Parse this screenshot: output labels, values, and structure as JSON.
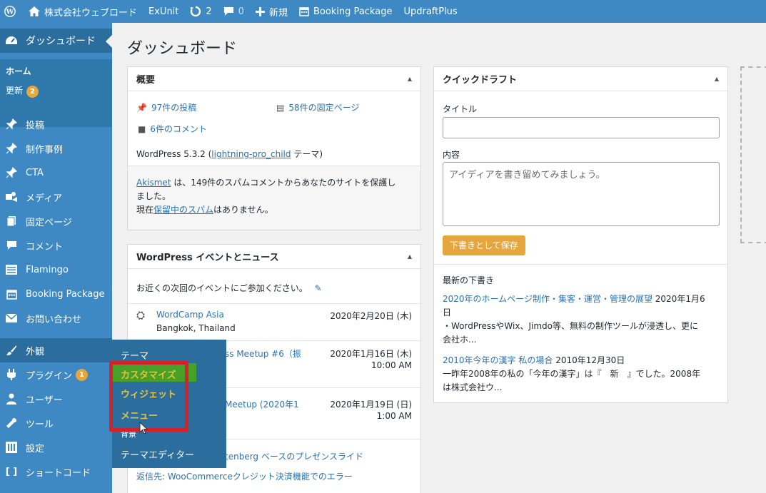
{
  "adminbar": {
    "site_name": "株式会社ウェブロード",
    "exunit": "ExUnit",
    "updates_count": "2",
    "comments_count": "0",
    "new_label": "新規",
    "booking": "Booking Package",
    "updraft": "UpdraftPlus"
  },
  "sidebar": {
    "dashboard": "ダッシュボード",
    "home": "ホーム",
    "updates": "更新",
    "updates_badge": "2",
    "items": [
      {
        "label": "投稿"
      },
      {
        "label": "制作事例"
      },
      {
        "label": "CTA"
      },
      {
        "label": "メディア"
      },
      {
        "label": "固定ページ"
      },
      {
        "label": "コメント"
      },
      {
        "label": "Flamingo"
      },
      {
        "label": "Booking Package"
      },
      {
        "label": "お問い合わせ"
      },
      {
        "label": "外観"
      },
      {
        "label": "プラグイン"
      },
      {
        "label": "ユーザー"
      },
      {
        "label": "ツール"
      },
      {
        "label": "設定"
      },
      {
        "label": "ショートコード"
      }
    ],
    "plugins_badge": "1"
  },
  "flyout": {
    "theme": "テーマ",
    "customize": "カスタマイズ",
    "widgets": "ウィジェット",
    "menus": "メニュー",
    "background": "背景",
    "theme_editor": "テーマエディター"
  },
  "page_title": "ダッシュボード",
  "glance": {
    "title": "概要",
    "posts": "97件の投稿",
    "pages": "58件の固定ページ",
    "comments": "6件のコメント",
    "wp_version_prefix": "WordPress 5.3.2 (",
    "theme_link": "lightning-pro_child",
    "wp_version_suffix": " テーマ)",
    "akismet_link": "Akismet",
    "akismet_text1": " は、149件のスパムコメントからあなたのサイトを保護し",
    "akismet_text2": "ました。",
    "spam_prefix": "現在",
    "spam_link": "保留中のスパム",
    "spam_suffix": "はありません。"
  },
  "events": {
    "title": "WordPress イベントとニュース",
    "intro": "お近くの次回のイベントにご参加ください。",
    "list": [
      {
        "name": "WordCamp Asia",
        "location": "Bangkok, Thailand",
        "date": "2020年2月20日 (木)",
        "time": ""
      },
      {
        "name": "ss Meetup #6（振",
        "location": "",
        "date": "2020年1月16日 (木)",
        "time": "10:00 AM"
      },
      {
        "name": "Meetup (2020年1",
        "location": "",
        "date": "2020年1月19日 (日)",
        "time": "1:00 AM"
      }
    ],
    "news1": "tenberg ベースのプレゼンスライド",
    "news2": "返信先: WooCommerceクレジット決済機能でのエラー"
  },
  "quick_draft": {
    "title": "クイックドラフト",
    "title_label": "タイトル",
    "content_label": "内容",
    "content_placeholder": "アイディアを書き留めてみましょう。",
    "save_button": "下書きとして保存",
    "recent_heading": "最新の下書き",
    "drafts": [
      {
        "title": "2020年のホームページ制作・集客・運営・管理の展望",
        "date": "2020年1月6",
        "date2": "日",
        "excerpt1": "・WordPressやWix、Jimdo等、無料の制作ツールが浸透し、更に",
        "excerpt2": "会社ホ..."
      },
      {
        "title": "2010年今年の漢字 私の場合",
        "date": "2010年12月30日",
        "excerpt1": "一昨年2008年の私の「今年の漢字」は『　新　』でした。2008年",
        "excerpt2": "は株式会社ウ..."
      }
    ]
  },
  "colors": {
    "adminbar": "#3e88c3",
    "sidebar_active": "#2b6e9e",
    "link": "#2a73b0",
    "badge": "#e5a63e",
    "highlight": "#d5222a"
  }
}
